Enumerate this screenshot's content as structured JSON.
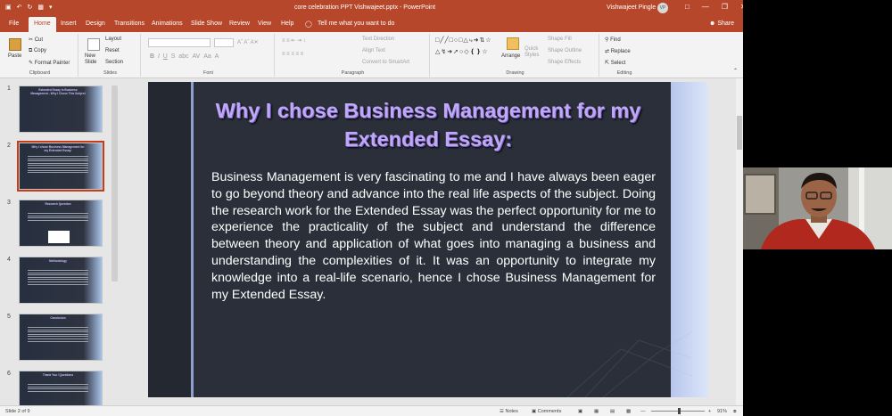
{
  "titlebar": {
    "document_title": "core celebration PPT Vishwajeet.pptx  -  PowerPoint",
    "user_name": "Vishwajeet Pingle",
    "avatar_initials": "VP"
  },
  "tabs": [
    "File",
    "Home",
    "Insert",
    "Design",
    "Transitions",
    "Animations",
    "Slide Show",
    "Review",
    "View",
    "Help"
  ],
  "tell_me": "Tell me what you want to do",
  "share_label": "Share",
  "ribbon": {
    "clipboard": {
      "paste": "Paste",
      "cut": "Cut",
      "copy": "Copy",
      "format_painter": "Format Painter",
      "label": "Clipboard"
    },
    "slides": {
      "new_slide": "New\nSlide",
      "layout": "Layout",
      "reset": "Reset",
      "section": "Section",
      "label": "Slides"
    },
    "font": {
      "label": "Font"
    },
    "paragraph": {
      "text_direction": "Text Direction",
      "align_text": "Align Text",
      "convert_smartart": "Convert to SmartArt",
      "label": "Paragraph"
    },
    "drawing": {
      "arrange": "Arrange",
      "quick_styles": "Quick\nStyles",
      "shape_fill": "Shape Fill",
      "shape_outline": "Shape Outline",
      "shape_effects": "Shape Effects",
      "label": "Drawing"
    },
    "editing": {
      "find": "Find",
      "replace": "Replace",
      "select": "Select",
      "label": "Editing"
    }
  },
  "thumbnails": [
    {
      "num": "1",
      "title": "Extended Essay in Business Management - Why I Chose This Subject"
    },
    {
      "num": "2",
      "title": "Why I chose Business Management for my Extended Essay:"
    },
    {
      "num": "3",
      "title": "Research Question"
    },
    {
      "num": "4",
      "title": "Methodology"
    },
    {
      "num": "5",
      "title": "Conclusion"
    },
    {
      "num": "6",
      "title": "Thank You / Questions"
    }
  ],
  "slide": {
    "title": "Why I chose Business Management for my Extended Essay:",
    "body": "Business Management is very fascinating to me and I have always been eager to go beyond theory and advance into the real life aspects of the subject. Doing the research work for the Extended Essay was the perfect opportunity for me to experience the practicality of the subject and understand the difference between theory and application of what goes into managing a business and understanding the complexities of it. It was an opportunity to integrate my knowledge into a real-life scenario, hence I chose Business Management for my Extended Essay."
  },
  "status": {
    "slide_counter": "Slide 2 of 9",
    "notes": "Notes",
    "comments": "Comments",
    "zoom": "91%"
  },
  "colors": {
    "accent": "#b7472a",
    "slide_bg": "#2a2f39",
    "title_color": "#bfa8f5"
  }
}
